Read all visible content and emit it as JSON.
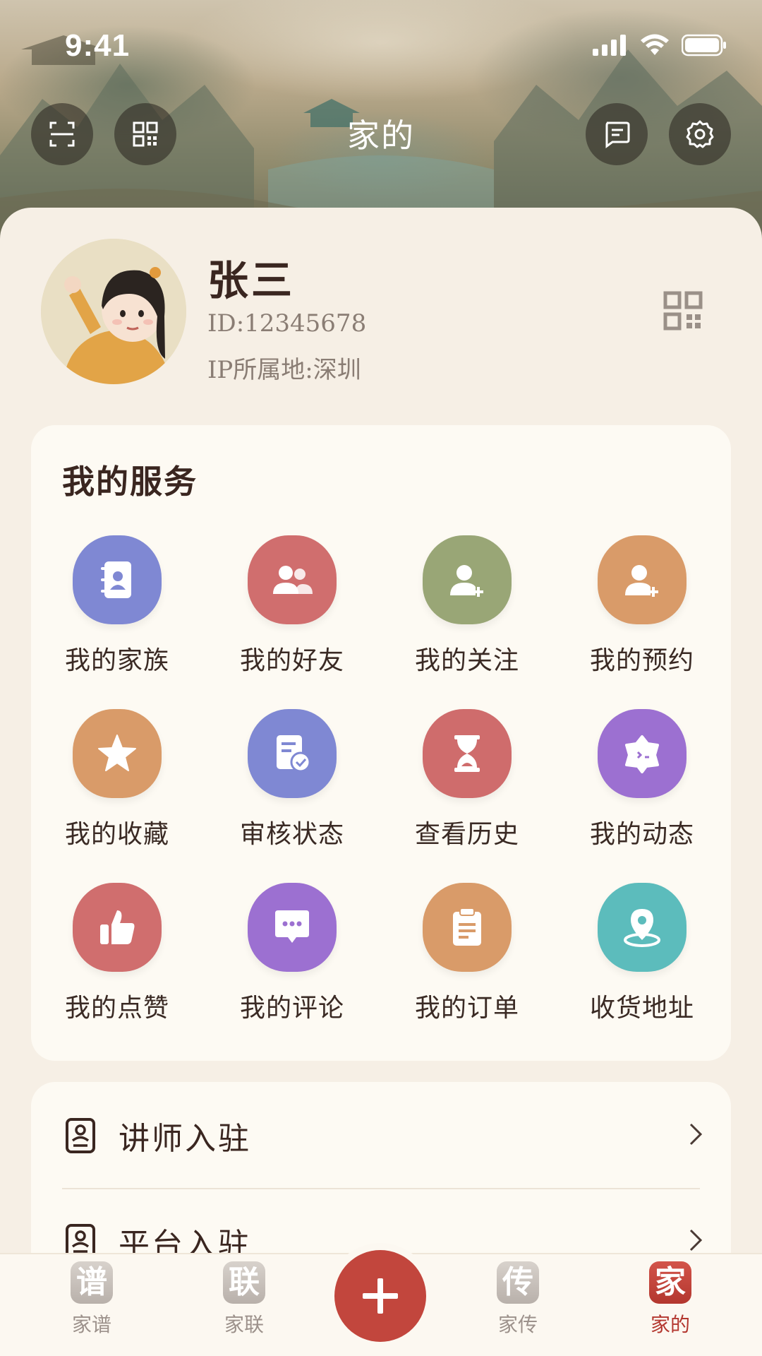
{
  "status": {
    "time": "9:41"
  },
  "header": {
    "title": "家的"
  },
  "profile": {
    "name": "张三",
    "id": "ID:12345678",
    "ip": "IP所属地:深圳"
  },
  "services": {
    "title": "我的服务",
    "items": [
      {
        "label": "我的家族",
        "icon": "address-book-icon",
        "color": "#7d86d2"
      },
      {
        "label": "我的好友",
        "icon": "friends-icon",
        "color": "#d06b6b"
      },
      {
        "label": "我的关注",
        "icon": "follow-user-icon",
        "color": "#97a476"
      },
      {
        "label": "我的预约",
        "icon": "add-user-icon",
        "color": "#d99a6a"
      },
      {
        "label": "我的收藏",
        "icon": "star-icon",
        "color": "#d99b69"
      },
      {
        "label": "审核状态",
        "icon": "review-doc-icon",
        "color": "#7d86d2"
      },
      {
        "label": "查看历史",
        "icon": "hourglass-icon",
        "color": "#cf6c6c"
      },
      {
        "label": "我的动态",
        "icon": "moments-icon",
        "color": "#9b6fd0"
      },
      {
        "label": "我的点赞",
        "icon": "thumbs-up-icon",
        "color": "#d06b6b"
      },
      {
        "label": "我的评论",
        "icon": "comment-icon",
        "color": "#9b6fd0"
      },
      {
        "label": "我的订单",
        "icon": "clipboard-icon",
        "color": "#d99b69"
      },
      {
        "label": "收货地址",
        "icon": "location-icon",
        "color": "#5cbcbc"
      }
    ]
  },
  "list": {
    "items": [
      {
        "label": "讲师入驻"
      },
      {
        "label": "平台入驻"
      }
    ]
  },
  "tabbar": {
    "items": [
      {
        "glyph": "谱",
        "label": "家谱",
        "active": false
      },
      {
        "glyph": "联",
        "label": "家联",
        "active": false
      },
      {
        "glyph": "传",
        "label": "家传",
        "active": false
      },
      {
        "glyph": "家",
        "label": "家的",
        "active": true
      }
    ],
    "accent": "#b3372f"
  }
}
